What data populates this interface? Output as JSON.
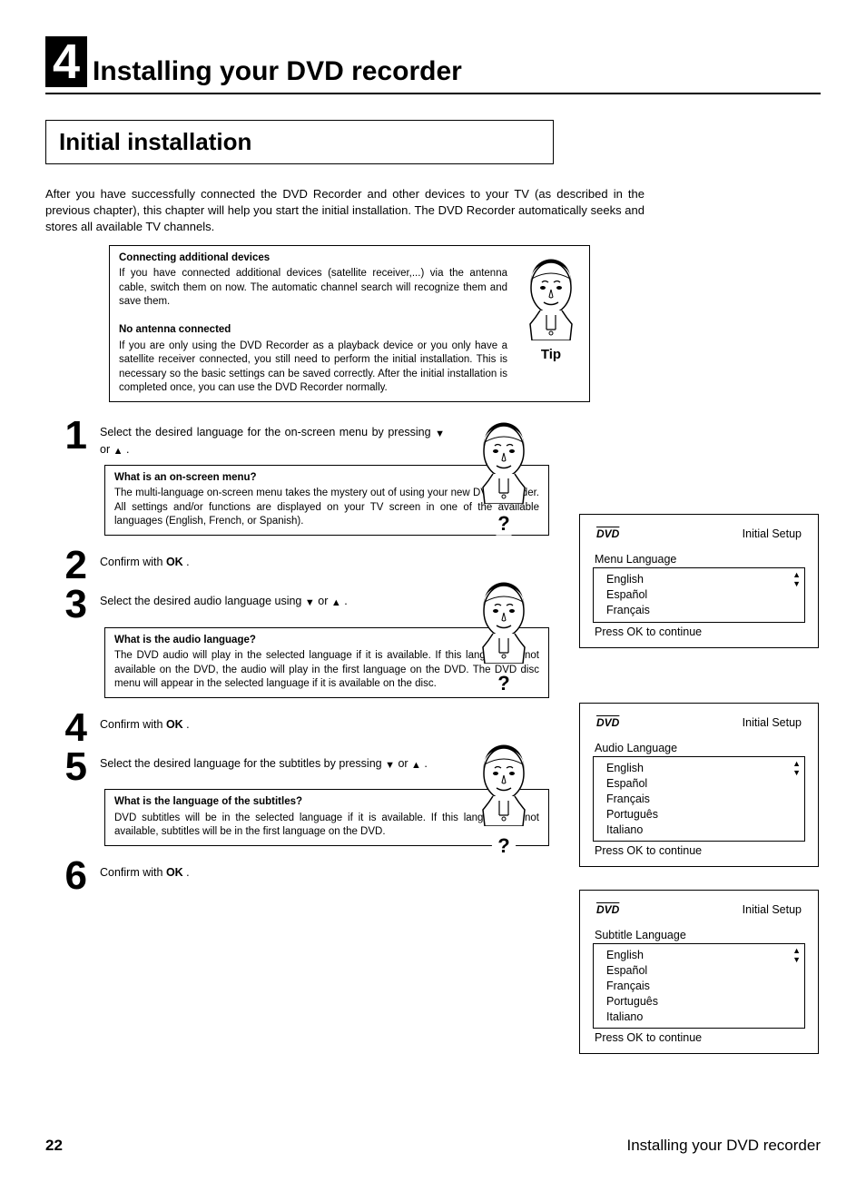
{
  "chapter": {
    "number": "4",
    "title": "Installing your DVD recorder"
  },
  "section_title": "Initial installation",
  "intro": "After you have successfully connected the DVD Recorder and other devices to your TV (as described in the previous chapter), this chapter will help you start the initial installation. The DVD Recorder automatically seeks and stores all available TV channels.",
  "tip": {
    "head1": "Connecting additional devices",
    "body1": "If you have connected additional devices (satellite receiver,...) via the antenna cable, switch them on now. The automatic channel search will recognize them and save them.",
    "head2": "No antenna connected",
    "body2": "If you are only using the DVD Recorder as a playback device or you only have a satellite receiver connected, you still need to perform the initial installation. This is necessary so the basic settings can be saved correctly. After the initial installation is completed once, you can use the DVD Recorder normally.",
    "label": "Tip"
  },
  "steps": {
    "s1_text_a": "Select the desired language for the on-screen menu by pressing ",
    "s1_text_b": " or ",
    "s1_text_c": " .",
    "s1_box_head": "What is an on-screen menu?",
    "s1_box_body": "The multi-language on-screen menu takes the mystery out of using your new DVD recorder. All settings and/or functions are displayed on your TV screen in one of the available languages (English, French, or Spanish).",
    "s2_text_a": "Confirm with ",
    "s2_ok": "OK",
    "s2_text_b": " .",
    "s3_text_a": "Select the desired audio language using ",
    "s3_text_b": " or ",
    "s3_text_c": " .",
    "s3_box_head": "What is the audio language?",
    "s3_box_body": "The DVD audio will play in the selected language if it is available. If this language is not available on the DVD, the audio will play in the first language on the DVD. The DVD disc menu will appear in the selected language if it is available on the disc.",
    "s4_text_a": "Confirm with ",
    "s4_ok": "OK",
    "s4_text_b": " .",
    "s5_text_a": "Select the desired language for the subtitles by pressing ",
    "s5_text_b": " or ",
    "s5_text_c": " .",
    "s5_box_head": "What is the language of the subtitles?",
    "s5_box_body": "DVD subtitles will be in the selected language if it is available. If this language is not available, subtitles will be in the first language on the DVD.",
    "s6_text_a": "Confirm with ",
    "s6_ok": "OK",
    "s6_text_b": " ."
  },
  "osd": {
    "dvd": "DVD",
    "setup": "Initial Setup",
    "ok_foot": "Press OK to continue",
    "menu_lang": {
      "label": "Menu Language",
      "opts": [
        "English",
        "Español",
        "Français"
      ]
    },
    "audio_lang": {
      "label": "Audio Language",
      "opts": [
        "English",
        "Español",
        "Français",
        "Português",
        "Italiano"
      ]
    },
    "sub_lang": {
      "label": "Subtitle Language",
      "opts": [
        "English",
        "Español",
        "Français",
        "Português",
        "Italiano"
      ]
    }
  },
  "footer": {
    "page": "22",
    "title": "Installing your DVD recorder"
  }
}
